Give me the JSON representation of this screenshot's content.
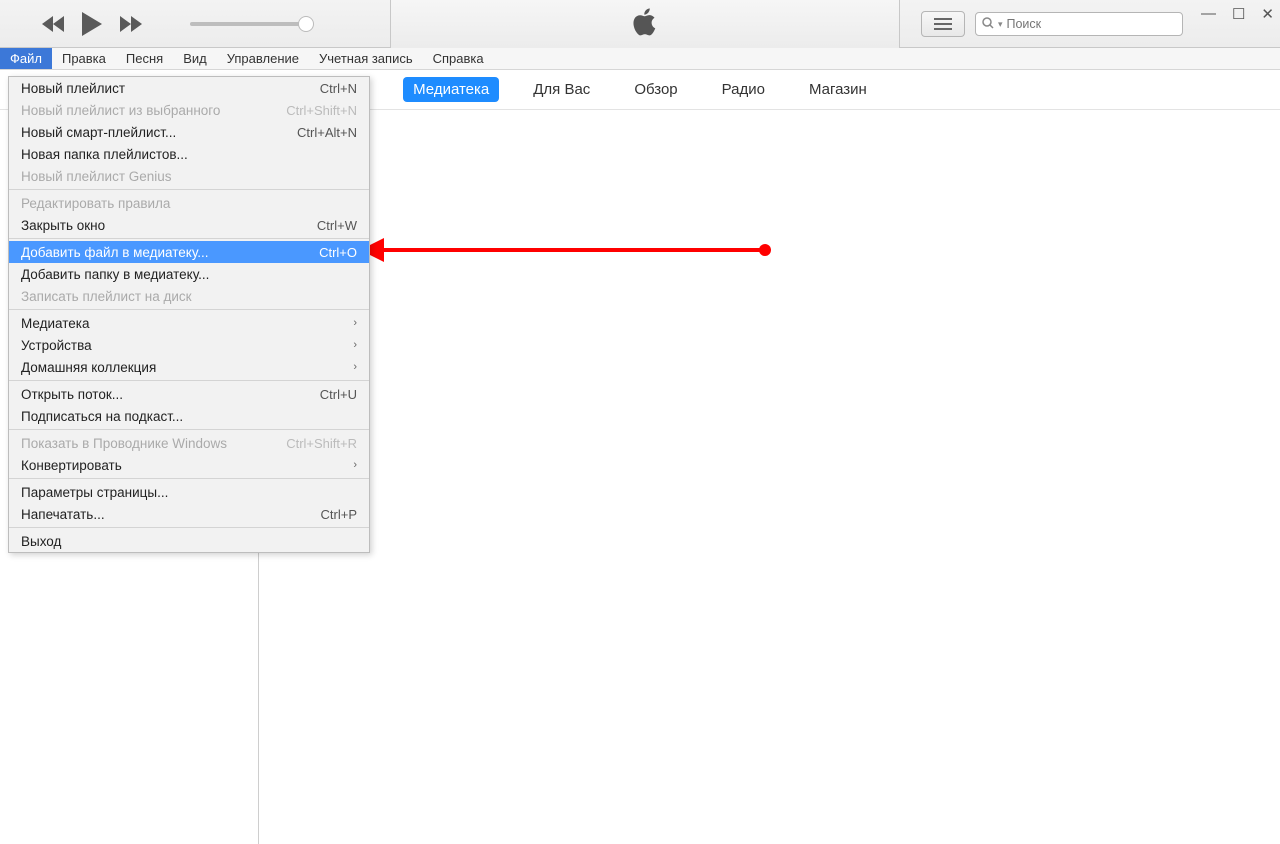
{
  "search": {
    "placeholder": "Поиск"
  },
  "menubar": [
    "Файл",
    "Правка",
    "Песня",
    "Вид",
    "Управление",
    "Учетная запись",
    "Справка"
  ],
  "subnav": [
    "Медиатека",
    "Для Вас",
    "Обзор",
    "Радио",
    "Магазин"
  ],
  "dropdown": [
    {
      "label": "Новый плейлист",
      "shortcut": "Ctrl+N"
    },
    {
      "label": "Новый плейлист из выбранного",
      "shortcut": "Ctrl+Shift+N",
      "disabled": true
    },
    {
      "label": "Новый смарт-плейлист...",
      "shortcut": "Ctrl+Alt+N"
    },
    {
      "label": "Новая папка плейлистов..."
    },
    {
      "label": "Новый плейлист Genius",
      "disabled": true
    },
    {
      "sep": true
    },
    {
      "label": "Редактировать правила",
      "disabled": true
    },
    {
      "label": "Закрыть окно",
      "shortcut": "Ctrl+W"
    },
    {
      "sep": true
    },
    {
      "label": "Добавить файл в медиатеку...",
      "shortcut": "Ctrl+O",
      "highlight": true
    },
    {
      "label": "Добавить папку в медиатеку..."
    },
    {
      "label": "Записать плейлист на диск",
      "disabled": true
    },
    {
      "sep": true
    },
    {
      "label": "Медиатека",
      "submenu": true
    },
    {
      "label": "Устройства",
      "submenu": true
    },
    {
      "label": "Домашняя коллекция",
      "submenu": true
    },
    {
      "sep": true
    },
    {
      "label": "Открыть поток...",
      "shortcut": "Ctrl+U"
    },
    {
      "label": "Подписаться на подкаст..."
    },
    {
      "sep": true
    },
    {
      "label": "Показать в Проводнике Windows",
      "shortcut": "Ctrl+Shift+R",
      "disabled": true
    },
    {
      "label": "Конвертировать",
      "submenu": true
    },
    {
      "sep": true
    },
    {
      "label": "Параметры страницы..."
    },
    {
      "label": "Напечатать...",
      "shortcut": "Ctrl+P"
    },
    {
      "sep": true
    },
    {
      "label": "Выход"
    }
  ]
}
